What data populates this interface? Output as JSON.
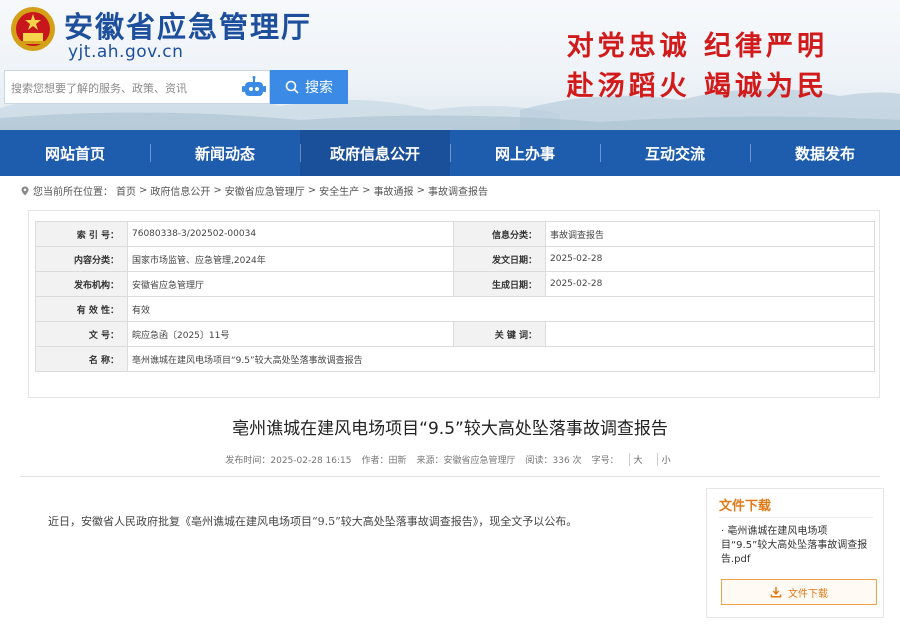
{
  "header": {
    "site_title": "安徽省应急管理厅",
    "site_url": "yjt.ah.gov.cn",
    "search_placeholder": "搜索您想要了解的服务、政策、资讯",
    "search_button": "搜索",
    "slogan_line1": "对党忠诚  纪律严明",
    "slogan_line2": "赴汤蹈火  竭诚为民"
  },
  "nav": {
    "items": [
      {
        "label": "网站首页"
      },
      {
        "label": "新闻动态"
      },
      {
        "label": "政府信息公开"
      },
      {
        "label": "网上办事"
      },
      {
        "label": "互动交流"
      },
      {
        "label": "数据发布"
      }
    ]
  },
  "breadcrumb": {
    "prefix": "您当前所在位置：",
    "items": [
      "首页",
      "政府信息公开",
      "安徽省应急管理厅",
      "安全生产",
      "事故通报",
      "事故调查报告"
    ],
    "sep": ">"
  },
  "meta": {
    "index_label": "索 引 号：",
    "index_value": "76080338-3/202502-00034",
    "info_cat_label": "信息分类：",
    "info_cat_value": "事故调查报告",
    "content_cat_label": "内容分类：",
    "content_cat_value": "国家市场监管、应急管理,2024年",
    "issue_date_label": "发文日期：",
    "issue_date_value": "2025-02-28",
    "publisher_label": "发布机构：",
    "publisher_value": "安徽省应急管理厅",
    "effect_date_label": "生成日期：",
    "effect_date_value": "2025-02-28",
    "validity_label": "有 效 性：",
    "validity_value": "有效",
    "docno_label": "文       号：",
    "docno_value": "皖应急函〔2025〕11号",
    "keywords_label": "关 键 词：",
    "keywords_value": "",
    "name_label": "名       称：",
    "name_value": "亳州谯城在建风电场项目“9.5”较大高处坠落事故调查报告"
  },
  "article": {
    "title": "亳州谯城在建风电场项目“9.5”较大高处坠落事故调查报告",
    "publish_time": "发布时间：2025-02-28 16:15",
    "author": "作者：田新",
    "source": "来源：安徽省应急管理厅",
    "views": "阅读：336 次",
    "font_label": "字号：",
    "font_large": "大",
    "font_small": "小",
    "body": "近日，安徽省人民政府批复《亳州谯城在建风电场项目“9.5”较大高处坠落事故调查报告》，现全文予以公布。"
  },
  "download": {
    "title": "文件下载",
    "file_name": "· 亳州谯城在建风电场项目“9.5”较大高处坠落事故调查报告.pdf",
    "button": "文件下载"
  },
  "colors": {
    "nav_bg": "#1e5cad",
    "title_blue": "#1d4f9c",
    "slogan_red": "#d21a1a",
    "accent_orange": "#e07a16",
    "search_btn": "#3a8ae6"
  }
}
